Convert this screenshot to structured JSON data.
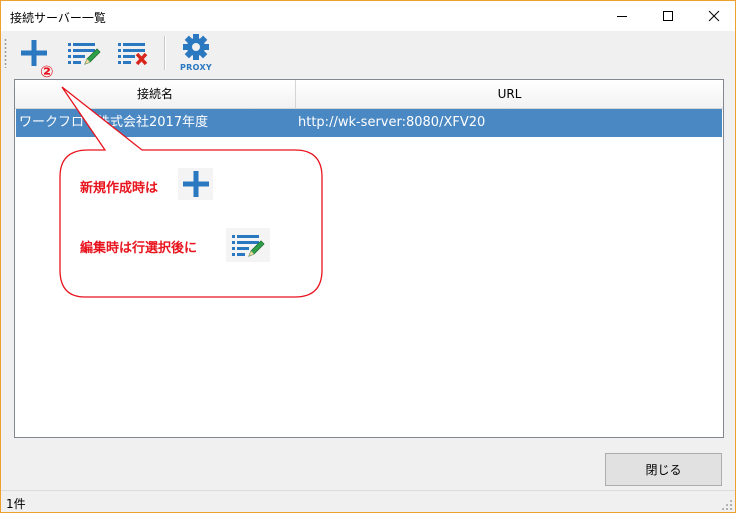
{
  "window": {
    "title": "接続サーバー一覧"
  },
  "toolbar": {
    "buttons": [
      {
        "name": "add",
        "icon": "plus-icon"
      },
      {
        "name": "edit",
        "icon": "edit-list-icon"
      },
      {
        "name": "delete",
        "icon": "delete-list-icon"
      },
      {
        "name": "proxy",
        "icon": "gear-icon",
        "label": "PROXY"
      }
    ]
  },
  "annotation": {
    "step_marker": "②",
    "new_text": "新規作成時は",
    "edit_text": "編集時は行選択後に",
    "color": "#e8141e"
  },
  "table": {
    "columns": [
      "接続名",
      "URL"
    ],
    "rows": [
      {
        "name": "ワークフロー株式会社2017年度",
        "url": "http://wk-server:8080/XFV20",
        "selected": true
      }
    ]
  },
  "footer": {
    "close_label": "閉じる"
  },
  "status": {
    "count_text": "1件"
  },
  "colors": {
    "accent_blue": "#2a78c0",
    "selection": "#4a88c4",
    "edit_green": "#2fa04a",
    "delete_red": "#d9261c"
  }
}
